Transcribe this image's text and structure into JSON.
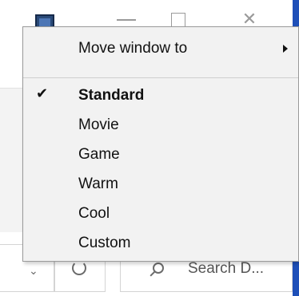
{
  "menu": {
    "move_window_to": "Move window to",
    "items": [
      {
        "label": "Standard",
        "checked": true
      },
      {
        "label": "Movie",
        "checked": false
      },
      {
        "label": "Game",
        "checked": false
      },
      {
        "label": "Warm",
        "checked": false
      },
      {
        "label": "Cool",
        "checked": false
      },
      {
        "label": "Custom",
        "checked": false
      }
    ],
    "check_glyph": "✔"
  },
  "titlebar": {
    "close_glyph": "✕"
  },
  "toolbar": {
    "search_placeholder": "Search D...",
    "dropdown_glyph": "⌄"
  },
  "colors": {
    "accent": "#1e4fb8",
    "menu_bg": "#f2f2f2"
  }
}
